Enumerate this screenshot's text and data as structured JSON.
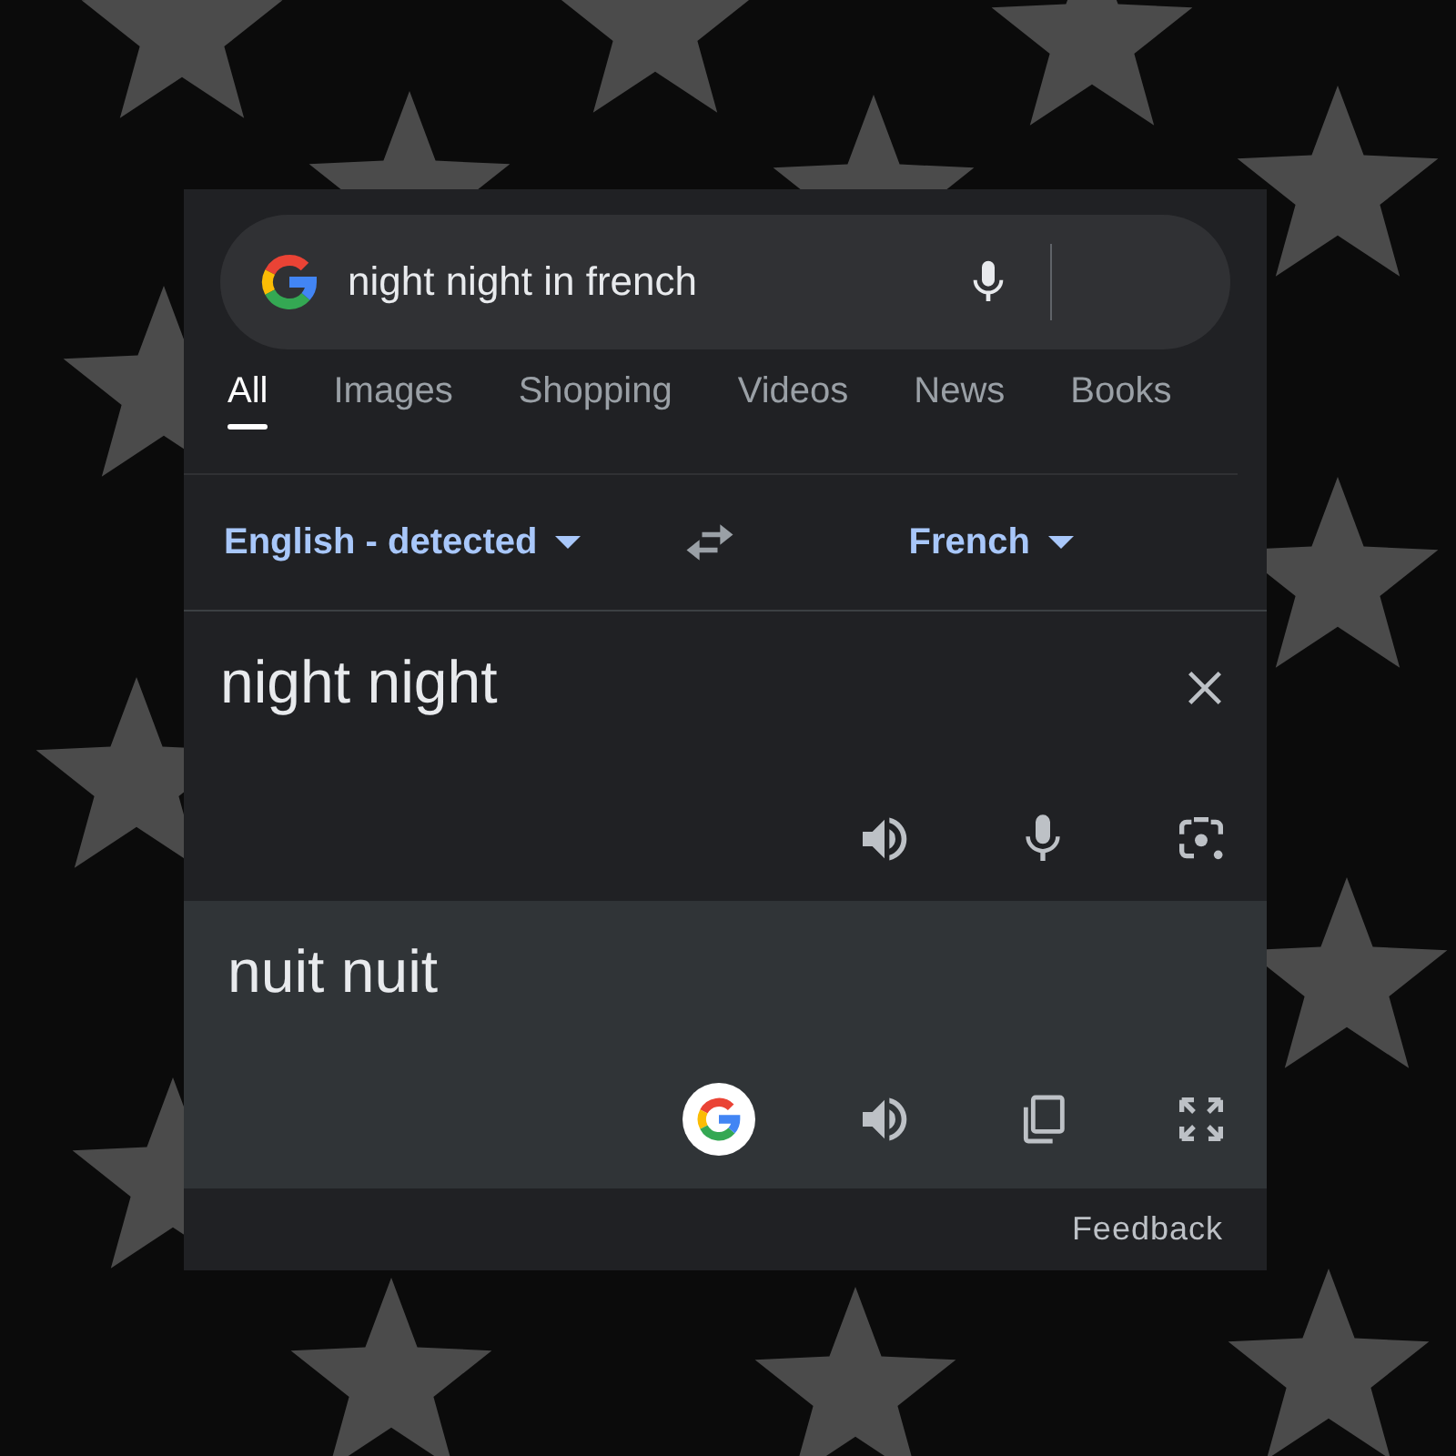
{
  "search": {
    "value": "night night in french"
  },
  "tabs": [
    {
      "label": "All",
      "selected": true
    },
    {
      "label": "Images",
      "selected": false
    },
    {
      "label": "Shopping",
      "selected": false
    },
    {
      "label": "Videos",
      "selected": false
    },
    {
      "label": "News",
      "selected": false
    },
    {
      "label": "Books",
      "selected": false
    }
  ],
  "translator": {
    "source_language": "English - detected",
    "target_language": "French",
    "input_text": "night night",
    "output_text": "nuit nuit"
  },
  "feedback": "Feedback"
}
